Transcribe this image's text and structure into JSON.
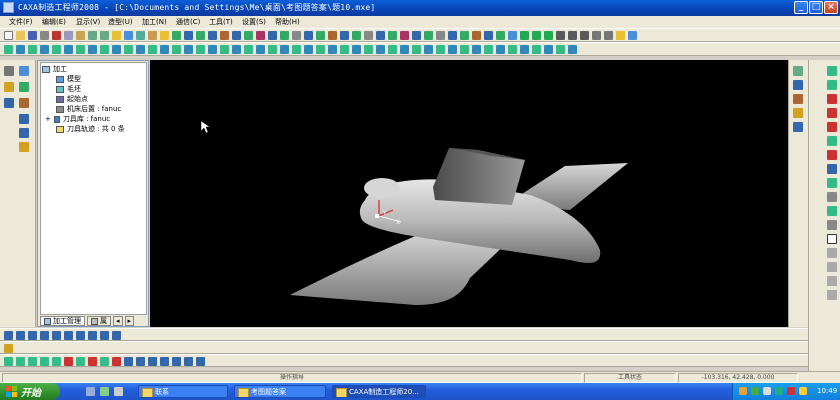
{
  "window": {
    "title": "CAXA制造工程师2008  - [C:\\Documents and Settings\\Me\\桌面\\考图题答案\\题10.mxe]",
    "controls": [
      "_",
      "□",
      "×"
    ]
  },
  "menu": [
    "文件(F)",
    "编辑(E)",
    "显示(V)",
    "造型(U)",
    "加工(N)",
    "通信(C)",
    "工具(T)",
    "设置(S)",
    "帮助(H)"
  ],
  "tree": {
    "root": "加工",
    "items": [
      {
        "label": "模型",
        "icon": "model-icon"
      },
      {
        "label": "毛坯",
        "icon": "blank-icon"
      },
      {
        "label": "起始点",
        "icon": "start-point-icon"
      },
      {
        "label": "机床后置 : fanuc",
        "icon": "machine-icon"
      },
      {
        "label": "刀具库 : fanuc",
        "icon": "tool-library-icon"
      },
      {
        "label": "刀具轨迹 : 共 0 条",
        "icon": "toolpath-folder-icon"
      }
    ],
    "tabs": [
      "加工管理",
      "属"
    ]
  },
  "status": {
    "prompt": "操作指导",
    "tool_state": "工具状态",
    "coords": "-103.316, 42.428, 0.000"
  },
  "taskbar": {
    "start": "开始",
    "tasks": [
      "联系",
      "考图题答案",
      "CAXA制造工程师20..."
    ],
    "clock": "10:49"
  },
  "colors": {
    "titlebar": "#0a4fc9",
    "canvas": "#000000",
    "model": "#bdbdbd",
    "taskbar": "#245edb",
    "start": "#2f8f2a"
  }
}
